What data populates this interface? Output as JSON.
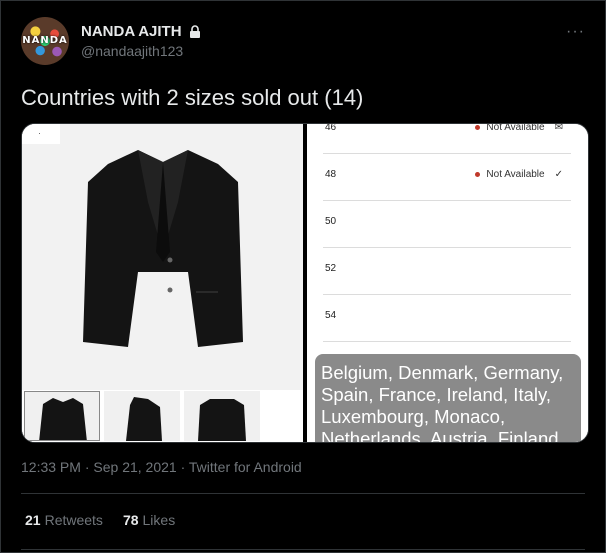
{
  "author": {
    "display_name": "NANDA AJITH",
    "handle": "@nandaajith123",
    "avatar_text": "NANDA",
    "protected_icon": "lock-icon"
  },
  "more_icon": "more-horizontal-icon",
  "more_glyph": "···",
  "tweet_text": "Countries with 2 sizes sold out (14)",
  "media": {
    "sizes": [
      {
        "size": "46",
        "status": "Not Available",
        "mark": "✉"
      },
      {
        "size": "48",
        "status": "Not Available",
        "mark": "✓"
      },
      {
        "size": "50",
        "status": "",
        "mark": ""
      },
      {
        "size": "52",
        "status": "",
        "mark": ""
      },
      {
        "size": "54",
        "status": "",
        "mark": ""
      }
    ],
    "countries_text": "Belgium, Denmark, Germany, Spain, France, Ireland, Italy, Luxembourg, Monaco, Netherlands, Austria, Finland"
  },
  "meta": {
    "time": "12:33 PM",
    "sep1": " · ",
    "date": "Sep 21, 2021",
    "sep2": " · ",
    "source": "Twitter for Android"
  },
  "stats": {
    "retweets_count": "21",
    "retweets_label": "Retweets",
    "likes_count": "78",
    "likes_label": "Likes"
  }
}
